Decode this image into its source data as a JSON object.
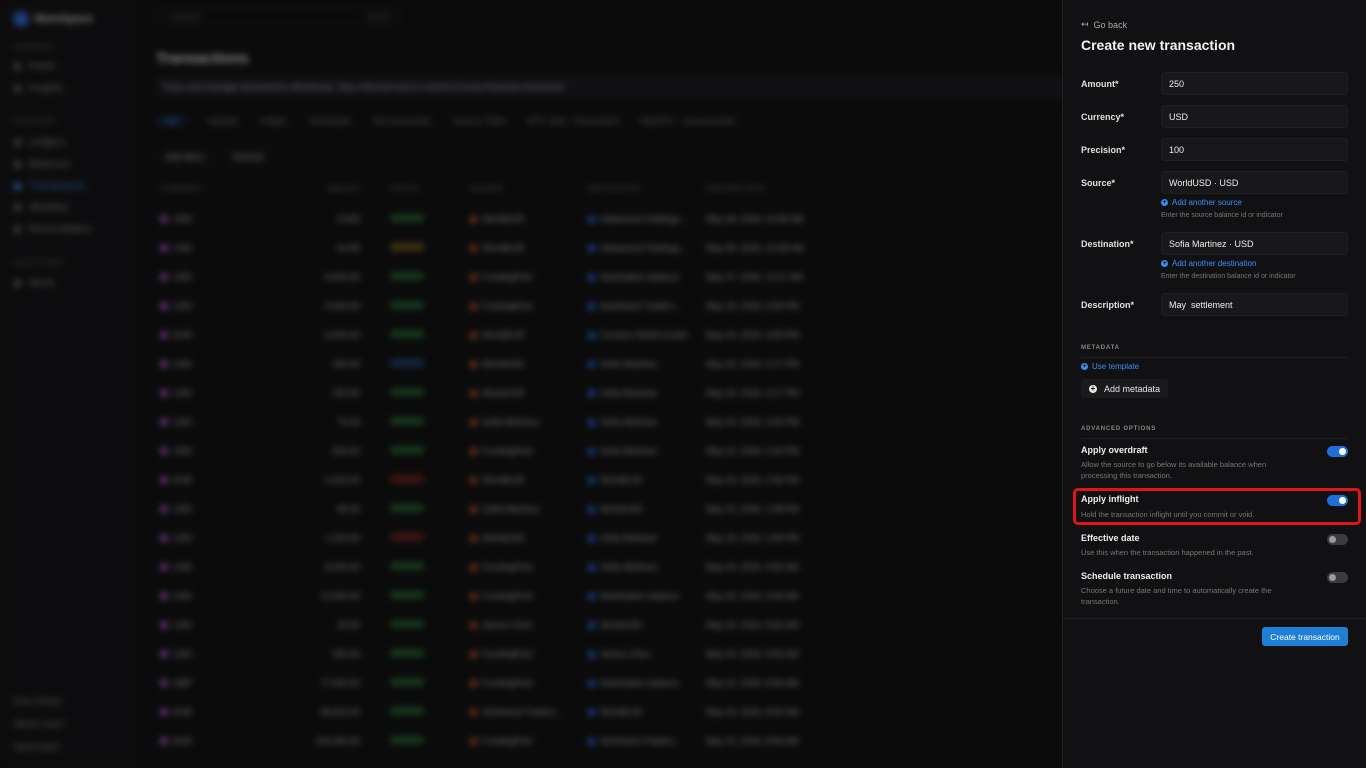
{
  "background": {
    "workspace": "WareSpace",
    "sections": [
      "GENERAL",
      "SOURCES",
      "SOLUTIONS"
    ],
    "nav": [
      {
        "label": "Home",
        "active": false
      },
      {
        "label": "Insights",
        "active": false
      },
      {
        "label": "Ledgers",
        "active": false
      },
      {
        "label": "Balances",
        "active": false
      },
      {
        "label": "Transactions",
        "active": true
      },
      {
        "label": "Identities",
        "active": false
      },
      {
        "label": "Reconciliation",
        "active": false
      },
      {
        "label": "Alerts",
        "active": false
      }
    ],
    "footer_nav": [
      "Docs library",
      "What's new?",
      "Need help?"
    ],
    "search_placeholder": "Search",
    "search_shortcut": "Ctrl+K",
    "page_title": "Transactions",
    "page_subtitle": "Track and manage transactions effortlessly. Stay informed and in control of every financial movement",
    "filters": [
      "All",
      "Applied",
      "Inflight",
      "Scheduled",
      "Not reconciled",
      "Source: EMA",
      "BTC: Bnk - Reconciled",
      "Bal/NTC - Unreconciled"
    ],
    "actions": [
      "Add filters",
      "Refresh"
    ],
    "columns": [
      "CURRENCY",
      "AMOUNT",
      "STATUS",
      "SOURCE",
      "DESTINATION",
      "CREATED DATE"
    ],
    "rows": [
      {
        "currency": "USD",
        "amount": "8,029",
        "status": "Applied",
        "source": "WorldEUR",
        "destination": "Hakewood Holdings...",
        "date": "May 28, 2026, 10:58 AM"
      },
      {
        "currency": "USD",
        "amount": "8,029",
        "status": "Inflight",
        "source": "WorldEUR",
        "destination": "Hakewood Holdings...",
        "date": "May 28, 2026, 10:58 AM"
      },
      {
        "currency": "USD",
        "amount": "6,500.00",
        "status": "Applied",
        "source": "FundingPool",
        "destination": "Destination balance",
        "date": "May 27, 2026, 11:57 AM"
      },
      {
        "currency": "USD",
        "amount": "5,000.00",
        "status": "Applied",
        "source": "FundingPool",
        "destination": "Northwind Traders...",
        "date": "May 23, 2026, 6:59 PM"
      },
      {
        "currency": "EUR",
        "amount": "6,500.00",
        "status": "Applied",
        "source": "WorldEUR",
        "destination": "Contoso Retail GmbH",
        "date": "May 23, 2026, 6:58 PM"
      },
      {
        "currency": "USD",
        "amount": "250.00",
        "status": "Scheduled",
        "source": "WorldUSD",
        "destination": "Sofia Martinez",
        "date": "May 23, 2026, 4:17 PM"
      },
      {
        "currency": "USD",
        "amount": "250.00",
        "status": "Applied",
        "source": "WorldUSD",
        "destination": "Sofia Martinez",
        "date": "May 23, 2026, 4:17 PM"
      },
      {
        "currency": "USD",
        "amount": "75.20",
        "status": "Applied",
        "source": "Sofia Martinez",
        "destination": "Sofia Martinez",
        "date": "May 23, 2026, 2:50 PM"
      },
      {
        "currency": "USD",
        "amount": "500.00",
        "status": "Applied",
        "source": "FundingPool",
        "destination": "Sofia Martinez",
        "date": "May 23, 2026, 2:00 PM"
      },
      {
        "currency": "EUR",
        "amount": "4,200.00",
        "status": "Rejected",
        "source": "WorldEUR",
        "destination": "WorldEUR",
        "date": "May 23, 2026, 2:48 PM"
      },
      {
        "currency": "USD",
        "amount": "89.00",
        "status": "Applied",
        "source": "Sofia Martinez",
        "destination": "WorldUSD",
        "date": "May 23, 2026, 2:48 PM"
      },
      {
        "currency": "USD",
        "amount": "1,150.00",
        "status": "Rejected",
        "source": "WorldUSD",
        "destination": "Sofia Martinez",
        "date": "May 23, 2026, 2:48 PM"
      },
      {
        "currency": "USD",
        "amount": "8,000.00",
        "status": "Applied",
        "source": "FundingPool",
        "destination": "Sofia Martinez",
        "date": "May 23, 2026, 9:56 AM"
      },
      {
        "currency": "USD",
        "amount": "12,000.00",
        "status": "Applied",
        "source": "FundingPool",
        "destination": "Destination balance",
        "date": "May 23, 2026, 9:36 AM"
      },
      {
        "currency": "USD",
        "amount": "42.50",
        "status": "Applied",
        "source": "James Chen",
        "destination": "WorldUSD",
        "date": "May 23, 2026, 8:56 AM"
      },
      {
        "currency": "USD",
        "amount": "250.00",
        "status": "Applied",
        "source": "FundingPool",
        "destination": "James Chen",
        "date": "May 23, 2026, 8:56 AM"
      },
      {
        "currency": "GBP",
        "amount": "77,000.00",
        "status": "Applied",
        "source": "FundingPool",
        "destination": "Destination balance",
        "date": "May 23, 2026, 8:56 AM"
      },
      {
        "currency": "EUR",
        "amount": "38,000.00",
        "status": "Applied",
        "source": "Northwind Traders...",
        "destination": "WorldEUR",
        "date": "May 23, 2026, 8:56 AM"
      },
      {
        "currency": "EUR",
        "amount": "103,000.00",
        "status": "Applied",
        "source": "FundingPool",
        "destination": "Northwind Traders...",
        "date": "May 23, 2026, 8:56 AM"
      }
    ]
  },
  "panel": {
    "go_back": "Go back",
    "title": "Create new transaction",
    "fields": {
      "amount": {
        "label": "Amount*",
        "value": "250"
      },
      "currency": {
        "label": "Currency*",
        "value": "USD"
      },
      "precision": {
        "label": "Precision*",
        "value": "100"
      },
      "source": {
        "label": "Source*",
        "value": "WorldUSD · USD",
        "link": "Add another source",
        "hint": "Enter the source balance id or indicator"
      },
      "destination": {
        "label": "Destination*",
        "value": "Sofia Martinez · USD",
        "link": "Add another destination",
        "hint": "Enter the destination balance id or indicator"
      },
      "description": {
        "label": "Description*",
        "value": "May  settlement"
      }
    },
    "metadata": {
      "heading": "METADATA",
      "use_template": "Use template",
      "add_metadata": "Add metadata"
    },
    "advanced": {
      "heading": "ADVANCED OPTIONS",
      "options": [
        {
          "title": "Apply overdraft",
          "desc": "Allow the source to go below its available balance when processing this transaction.",
          "on": true
        },
        {
          "title": "Apply inflight",
          "desc": "Hold the transaction inflight until you commit or void.",
          "on": true
        },
        {
          "title": "Effective date",
          "desc": "Use this when the transaction happened in the past.",
          "on": false
        },
        {
          "title": "Schedule transaction",
          "desc": "Choose a future date and time to automatically create the transaction.",
          "on": false
        }
      ]
    },
    "submit": "Create transaction",
    "colors": {
      "accent": "#1f7fd6",
      "highlight": "#e01515"
    }
  }
}
